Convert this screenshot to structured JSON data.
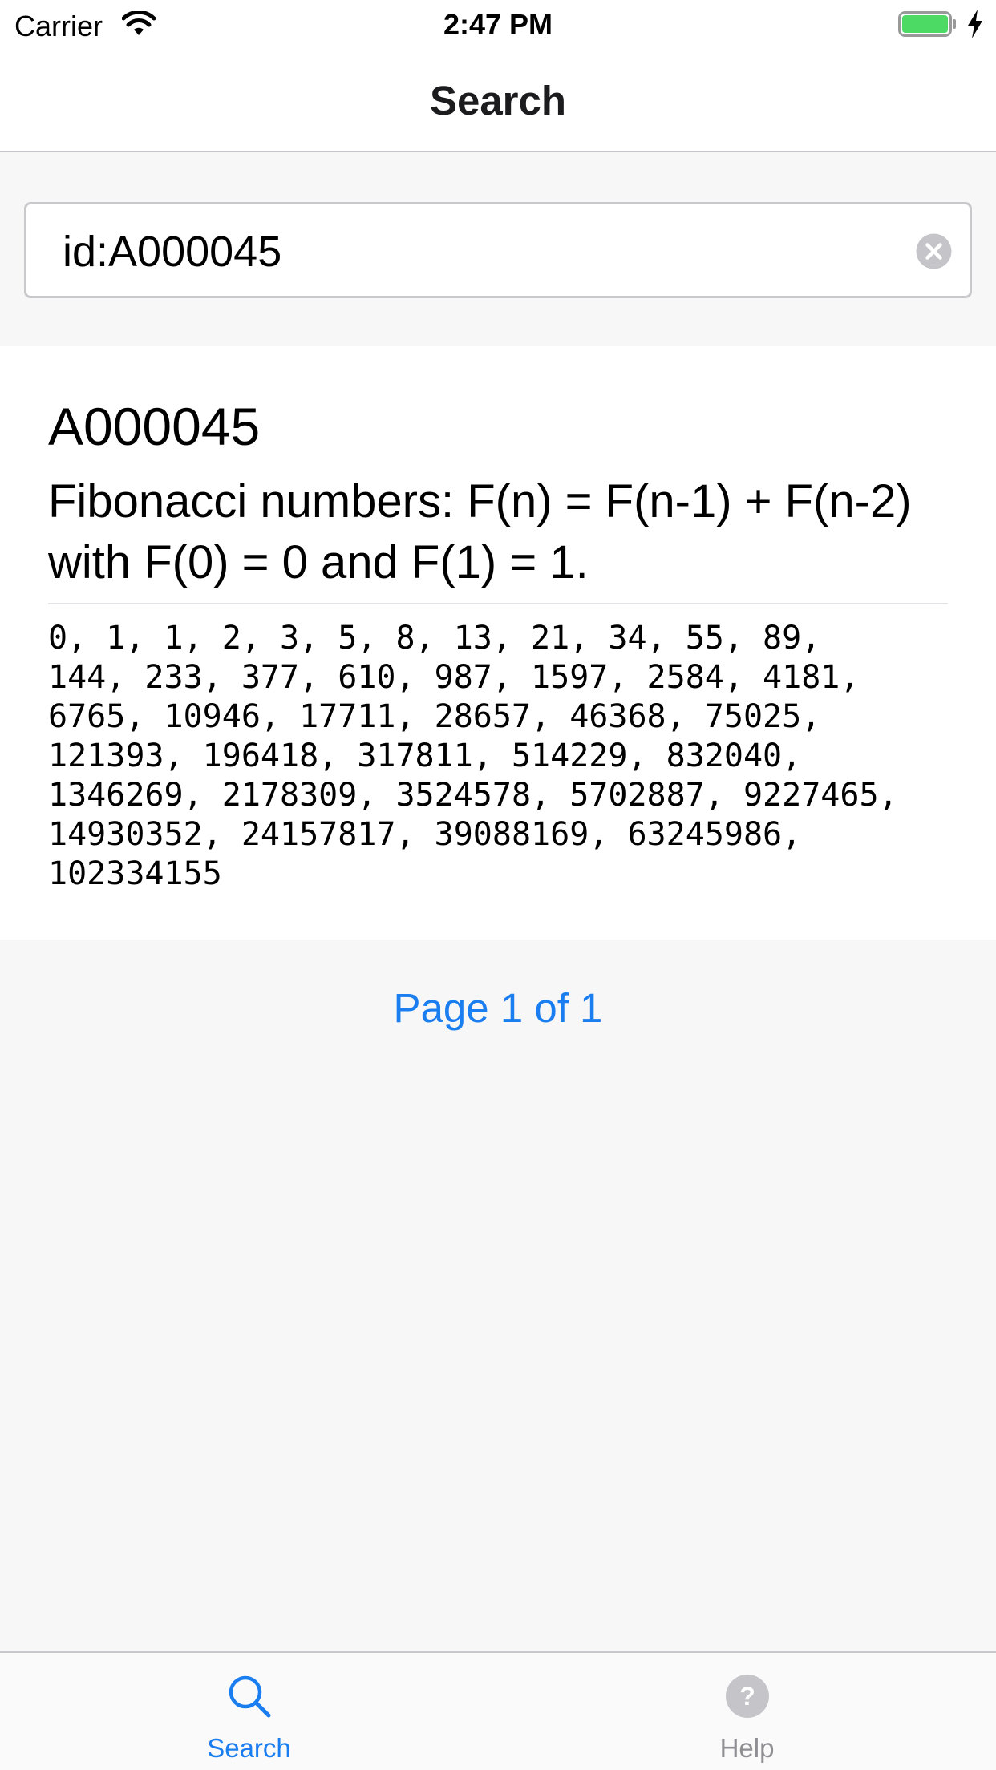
{
  "status_bar": {
    "carrier": "Carrier",
    "time": "2:47 PM",
    "battery_color": "#4cd964"
  },
  "nav": {
    "title": "Search"
  },
  "search": {
    "value": "id:A000045"
  },
  "result": {
    "id": "A000045",
    "name": "Fibonacci numbers: F(n) = F(n-1) + F(n-2) with F(0) = 0 and F(1) = 1.",
    "terms": "0, 1, 1, 2, 3, 5, 8, 13, 21, 34, 55, 89,\n144, 233, 377, 610, 987, 1597, 2584, 4181,\n6765, 10946, 17711, 28657, 46368, 75025,\n121393, 196418, 317811, 514229, 832040,\n1346269, 2178309, 3524578, 5702887, 9227465,\n14930352, 24157817, 39088169, 63245986,\n102334155"
  },
  "pagination": {
    "label": "Page 1 of 1"
  },
  "tab_bar": {
    "tabs": [
      {
        "label": "Search",
        "icon": "magnifier-icon",
        "active": true
      },
      {
        "label": "Help",
        "icon": "question-circle-icon",
        "active": false
      }
    ],
    "active_color": "#1a7ef0",
    "inactive_color": "#8e8e93"
  }
}
